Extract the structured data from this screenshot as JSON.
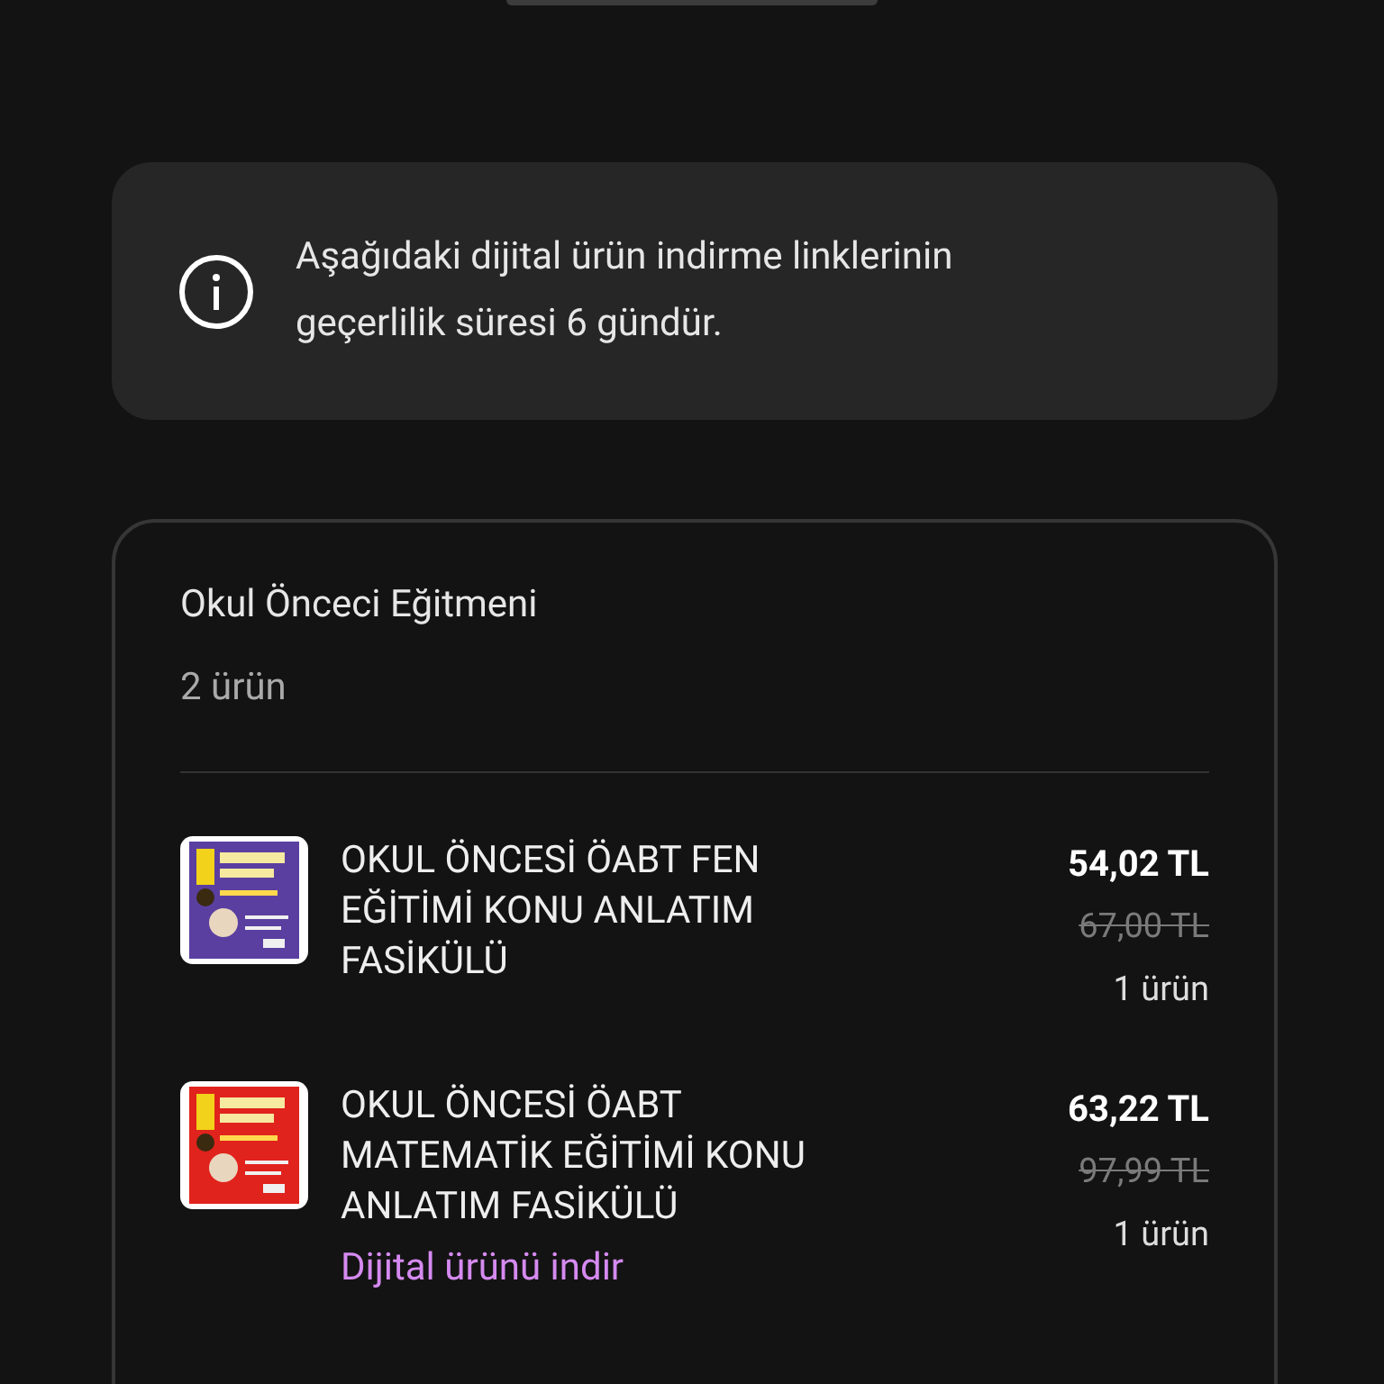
{
  "notice": {
    "text": "Aşağıdaki dijital ürün indirme linklerinin geçerlilik süresi 6 gündür."
  },
  "order": {
    "seller": "Okul Önceci Eğitmeni",
    "count": "2 ürün",
    "items": [
      {
        "title": "OKUL ÖNCESİ ÖABT FEN EĞİTİMİ KONU ANLATIM FASİKÜLÜ",
        "price": "54,02 TL",
        "old_price": "67,00 TL",
        "quantity": "1 ürün"
      },
      {
        "title": "OKUL ÖNCESİ ÖABT MATEMATİK EĞİTİMİ KONU ANLATIM FASİKÜLÜ",
        "price": "63,22 TL",
        "old_price": "97,99 TL",
        "quantity": "1 ürün",
        "download_link": "Dijital ürünü indir"
      }
    ]
  }
}
